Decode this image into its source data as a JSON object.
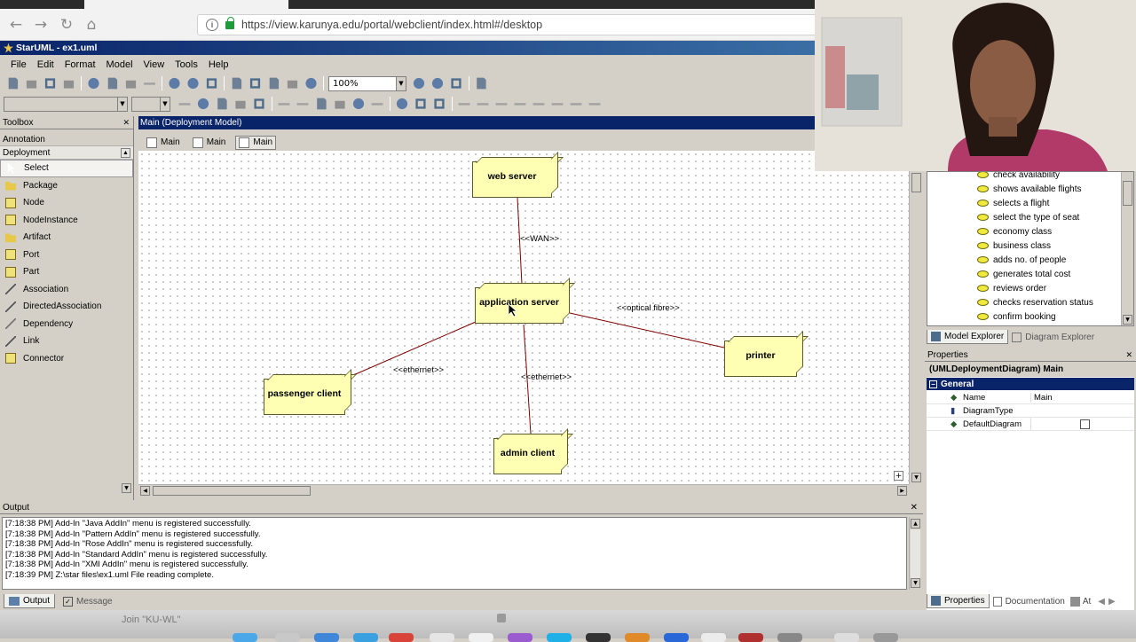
{
  "browser": {
    "url": "https://view.karunya.edu/portal/webclient/index.html#/desktop"
  },
  "app": {
    "title": "StarUML - ex1.uml",
    "menu": [
      "File",
      "Edit",
      "Format",
      "Model",
      "View",
      "Tools",
      "Help"
    ],
    "zoom": "100%"
  },
  "toolbox": {
    "header": "Toolbox",
    "categories": [
      "Annotation",
      "Deployment"
    ],
    "items": [
      {
        "label": "Select",
        "icon": "cursor-icon"
      },
      {
        "label": "Package",
        "icon": "package-icon"
      },
      {
        "label": "Node",
        "icon": "node-icon"
      },
      {
        "label": "NodeInstance",
        "icon": "node-instance-icon"
      },
      {
        "label": "Artifact",
        "icon": "artifact-icon"
      },
      {
        "label": "Port",
        "icon": "port-icon"
      },
      {
        "label": "Part",
        "icon": "part-icon"
      },
      {
        "label": "Association",
        "icon": "association-icon"
      },
      {
        "label": "DirectedAssociation",
        "icon": "directed-association-icon"
      },
      {
        "label": "Dependency",
        "icon": "dependency-icon"
      },
      {
        "label": "Link",
        "icon": "link-icon"
      },
      {
        "label": "Connector",
        "icon": "connector-icon"
      }
    ]
  },
  "diagram": {
    "header": "Main (Deployment Model)",
    "tabs": [
      "Main",
      "Main",
      "Main"
    ],
    "nodes": {
      "web_server": "web server",
      "application_server": "application server",
      "printer": "printer",
      "passenger_client": "passenger client",
      "admin_client": "admin client"
    },
    "edge_labels": {
      "wan": "<<WAN>>",
      "optical": "<<optical fibre>>",
      "ethernet_passenger": "<<ethernet>>",
      "ethernet_admin": "<<ethernet>>"
    },
    "colors": {
      "node_fill": "#ffffb3",
      "edge": "#800000"
    }
  },
  "model_explorer": {
    "items": [
      "check availability",
      "shows available flights",
      "selects a flight",
      "select the type of seat",
      "economy class",
      "business class",
      "adds no. of people",
      "generates total cost",
      "reviews order",
      "checks reservation status",
      "confirm booking"
    ],
    "tabs": [
      "Model Explorer",
      "Diagram Explorer"
    ]
  },
  "properties": {
    "header": "Properties",
    "title": "(UMLDeploymentDiagram) Main",
    "section": "General",
    "rows": [
      {
        "name": "Name",
        "value": "Main"
      },
      {
        "name": "DiagramType",
        "value": ""
      },
      {
        "name": "DefaultDiagram",
        "value": ""
      }
    ],
    "tabs": [
      "Properties",
      "Documentation",
      "At"
    ]
  },
  "output": {
    "header": "Output",
    "lines": [
      "[7:18:38 PM]   Add-In \"Java AddIn\" menu is registered successfully.",
      "[7:18:38 PM]   Add-In \"Pattern AddIn\" menu is registered successfully.",
      "[7:18:38 PM]   Add-In \"Rose AddIn\" menu is registered successfully.",
      "[7:18:38 PM]   Add-In \"Standard AddIn\" menu is registered successfully.",
      "[7:18:38 PM]   Add-In \"XMI AddIn\" menu is registered successfully.",
      "[7:18:39 PM]   Z:\\star files\\ex1.uml File reading complete."
    ],
    "tabs": [
      "Output",
      "Message"
    ]
  },
  "taskbar": {
    "join_text": "Join \"KU-WL\""
  }
}
